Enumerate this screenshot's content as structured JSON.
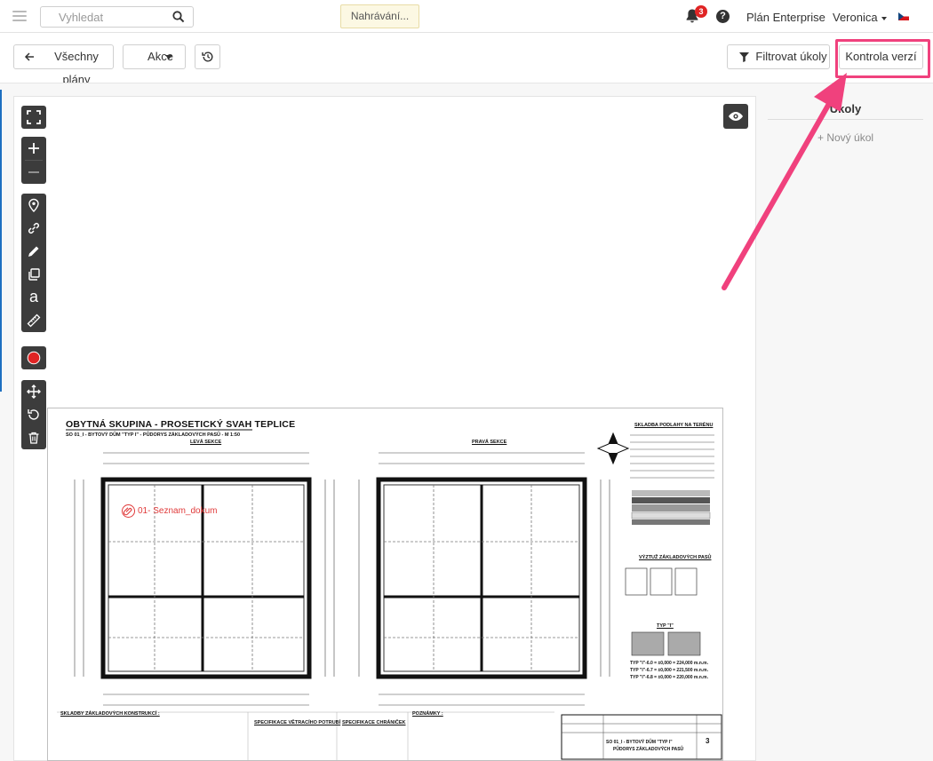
{
  "topbar": {
    "search_placeholder": "Vyhledat",
    "upload_status": "Nahrávání...",
    "notification_count": "3",
    "help_label": "?",
    "plan_label": "Plán Enterprise",
    "user_name": "Veronica",
    "language_flag": "cz-flag"
  },
  "toolbar": {
    "back_label": "Všechny plány",
    "actions_label": "Akce",
    "history_icon": "history-icon",
    "filter_label": "Filtrovat úkoly",
    "version_check_label": "Kontrola verzí"
  },
  "tools": {
    "fullscreen": "fullscreen-icon",
    "zoom_in": "zoom-in-icon",
    "zoom_out": "zoom-out-icon",
    "pin": "map-pin-icon",
    "link": "link-icon",
    "pencil": "pencil-icon",
    "copy": "copy-icon",
    "text": "a",
    "ruler": "ruler-icon",
    "record": "record-icon",
    "move": "move-icon",
    "rotate": "rotate-icon",
    "delete": "trash-icon",
    "visibility": "eye-icon"
  },
  "drawing": {
    "title": "OBYTNÁ SKUPINA - PROSETICKÝ SVAH TEPLICE",
    "subtitle": "SO 01_I - BYTOVÝ DŮM \"TYP I\" - PŮDORYS ZÁKLADOVÝCH PASŮ - M 1:50",
    "left_section": "LEVÁ SEKCE",
    "right_section": "PRAVÁ SEKCE",
    "document_pin": "01- Seznam_dokum",
    "legend_title": "SKLADBA PODLAHY NA TERÉNU",
    "reinforcement_title": "VÝZTUŽ ZÁKLADOVÝCH PASŮ",
    "type_label": "TYP \"I\"",
    "composition_title": "SKLADBY ZÁKLADOVÝCH KONSTRUKCÍ :",
    "ventilation_title": "SPECIFIKACE VĚTRACÍHO POTRUBÍ",
    "protector_title": "SPECIFIKACE CHRÁNIČEK",
    "notes_title": "POZNÁMKY :",
    "heights": [
      "TYP \"I\"-6.0 = ±0,000 = 224,000 m.n.m.",
      "TYP \"I\"-6.7 = ±0,000 = 221,500 m.n.m.",
      "TYP \"I\"-6.8 = ±0,000 = 220,000 m.n.m."
    ],
    "titleblock_heading": "SO 01_I - BYTOVÝ DŮM \"TYP I\"",
    "titleblock_sub": "PŮDORYS ZÁKLADOVÝCH PASŮ",
    "sheet_number": "3"
  },
  "panel": {
    "title": "Úkoly",
    "new_task": "+ Nový úkol"
  },
  "colors": {
    "highlight": "#f0417d",
    "record": "#e02424",
    "accent": "#1e6fc0"
  }
}
